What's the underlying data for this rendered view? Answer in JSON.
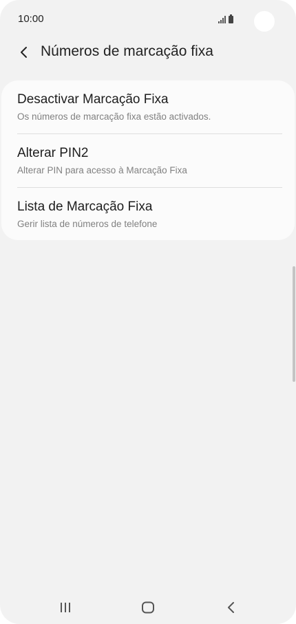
{
  "status_bar": {
    "time": "10:00",
    "icons": [
      "signal-icon",
      "battery-icon"
    ]
  },
  "header": {
    "back_icon": "chevron-left-icon",
    "title": "Números de marcação fixa"
  },
  "list": {
    "items": [
      {
        "title": "Desactivar Marcação Fixa",
        "subtitle": "Os números de marcação fixa estão activados."
      },
      {
        "title": "Alterar PIN2",
        "subtitle": "Alterar PIN para acesso à Marcação Fixa"
      },
      {
        "title": "Lista de Marcação Fixa",
        "subtitle": "Gerir lista de números de telefone"
      }
    ]
  },
  "nav_bar": {
    "buttons": [
      "recent-apps-icon",
      "home-icon",
      "back-icon"
    ]
  },
  "colors": {
    "background": "#f2f2f2",
    "card": "#fbfbfb",
    "title_text": "#1d1d1d",
    "subtitle_text": "#808080"
  }
}
